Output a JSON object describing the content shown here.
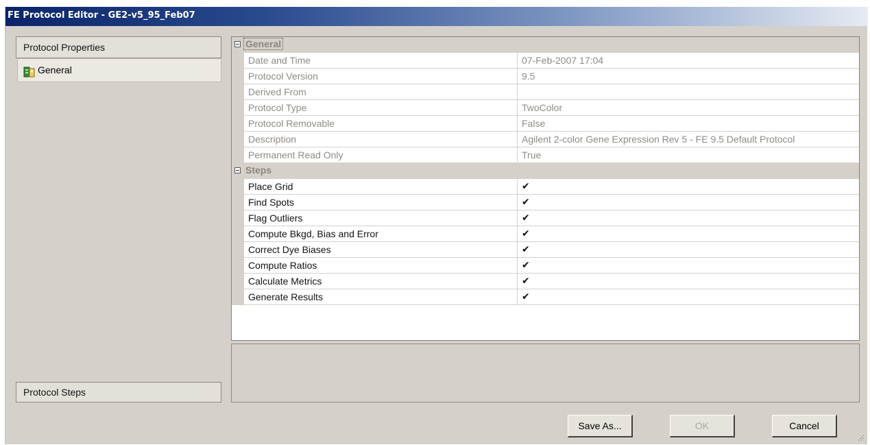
{
  "window": {
    "title": "FE Protocol Editor - GE2-v5_95_Feb07"
  },
  "left_panel": {
    "protocol_properties_label": "Protocol Properties",
    "general_item_label": "General",
    "protocol_steps_label": "Protocol Steps"
  },
  "grid": {
    "categories": {
      "general": "General",
      "steps": "Steps"
    },
    "general_rows": [
      {
        "name": "Date and Time",
        "value": "07-Feb-2007 17:04"
      },
      {
        "name": "Protocol Version",
        "value": "9.5"
      },
      {
        "name": "Derived From",
        "value": ""
      },
      {
        "name": "Protocol Type",
        "value": "TwoColor"
      },
      {
        "name": "Protocol Removable",
        "value": "False"
      },
      {
        "name": "Description",
        "value": "Agilent 2-color Gene Expression Rev 5 - FE 9.5 Default Protocol"
      },
      {
        "name": "Permanent Read Only",
        "value": "True"
      }
    ],
    "steps_rows": [
      {
        "name": "Place Grid",
        "value": "✔"
      },
      {
        "name": "Find Spots",
        "value": "✔"
      },
      {
        "name": "Flag Outliers",
        "value": "✔"
      },
      {
        "name": "Compute Bkgd, Bias and Error",
        "value": "✔"
      },
      {
        "name": "Correct Dye Biases",
        "value": "✔"
      },
      {
        "name": "Compute Ratios",
        "value": "✔"
      },
      {
        "name": "Calculate Metrics",
        "value": "✔"
      },
      {
        "name": "Generate Results",
        "value": "✔"
      }
    ]
  },
  "buttons": {
    "save_as": "Save As...",
    "ok": "OK",
    "cancel": "Cancel"
  },
  "icons": {
    "general": "protocol-general-icon",
    "collapse": "collapse-icon",
    "resize": "resize-grip-icon"
  },
  "colors": {
    "title_start": "#0a246a",
    "window_bg": "#d5d1ca",
    "readonly_text": "#8e8b86"
  }
}
